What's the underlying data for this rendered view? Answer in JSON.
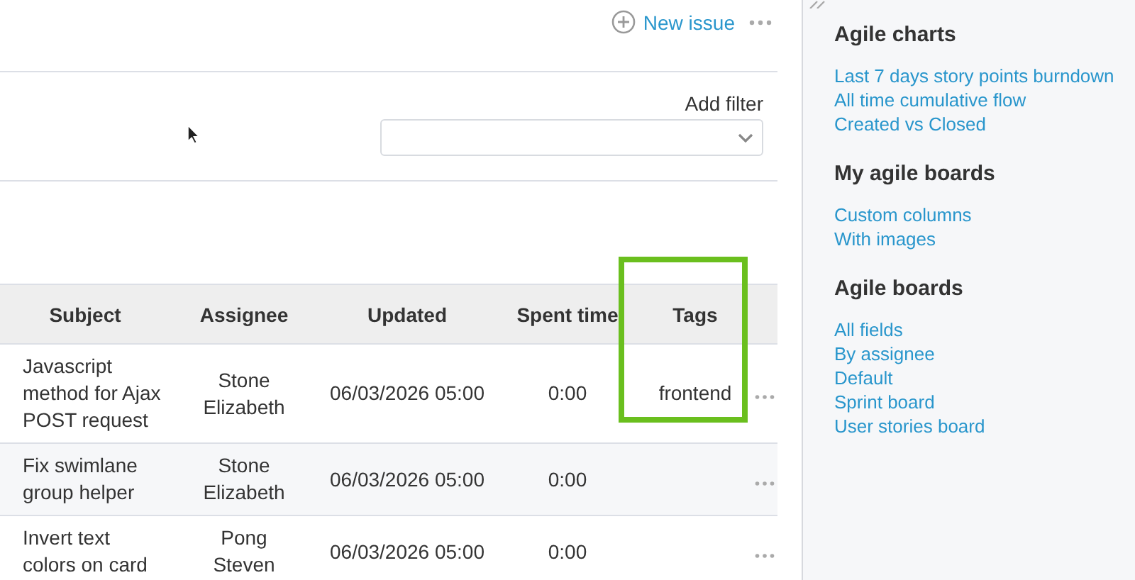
{
  "toolbar": {
    "new_issue": "New issue"
  },
  "filter": {
    "label": "Add filter"
  },
  "table": {
    "columns": [
      "Subject",
      "Assignee",
      "Updated",
      "Spent time",
      "Tags"
    ],
    "rows": [
      {
        "subject": "Javascript method for Ajax POST request",
        "assignee": "Stone Elizabeth",
        "updated": "06/03/2026 05:00",
        "spent_time": "0:00",
        "tags": "frontend"
      },
      {
        "subject": "Fix swimlane group helper",
        "assignee": "Stone Elizabeth",
        "updated": "06/03/2026 05:00",
        "spent_time": "0:00"
      },
      {
        "subject": "Invert text colors on card",
        "assignee": "Pong Steven",
        "updated": "06/03/2026 05:00",
        "spent_time": "0:00"
      }
    ]
  },
  "sidebar": {
    "sections": [
      {
        "title": "Agile charts",
        "links": [
          "Last 7 days story points burndown",
          "All time cumulative flow",
          "Created vs Closed"
        ]
      },
      {
        "title": "My agile boards",
        "links": [
          "Custom columns",
          "With images"
        ]
      },
      {
        "title": "Agile boards",
        "links": [
          "All fields",
          "By assignee",
          "Default",
          "Sprint board",
          "User stories board"
        ]
      }
    ]
  }
}
